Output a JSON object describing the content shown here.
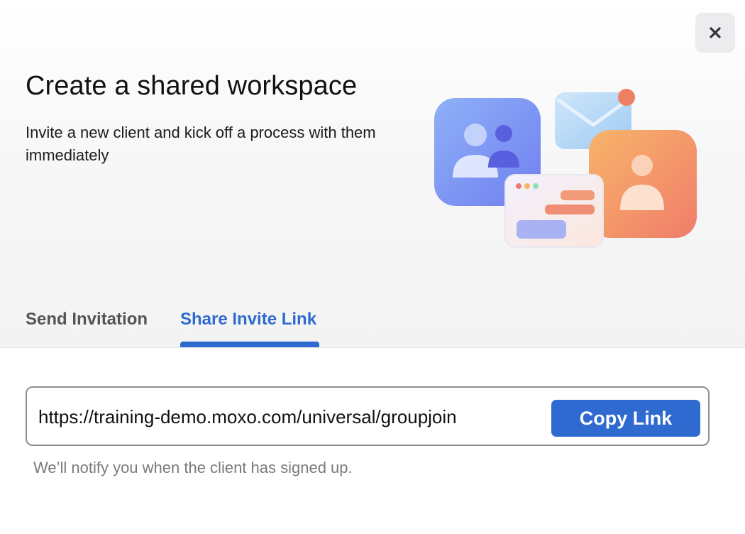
{
  "dialog": {
    "title": "Create a shared workspace",
    "subtitle": "Invite a new client and kick off a process with them immediately",
    "close_icon": "close-icon"
  },
  "tabs": [
    {
      "label": "Send Invitation",
      "active": false
    },
    {
      "label": "Share Invite Link",
      "active": true
    }
  ],
  "invite_link": {
    "value": "https://training-demo.moxo.com/universal/groupjoin",
    "copy_label": "Copy Link"
  },
  "hint": "We’ll notify you when the client has signed up.",
  "colors": {
    "accent": "#2f6ad0",
    "tab_inactive": "#555558",
    "hint_text": "#7a7a7e"
  }
}
